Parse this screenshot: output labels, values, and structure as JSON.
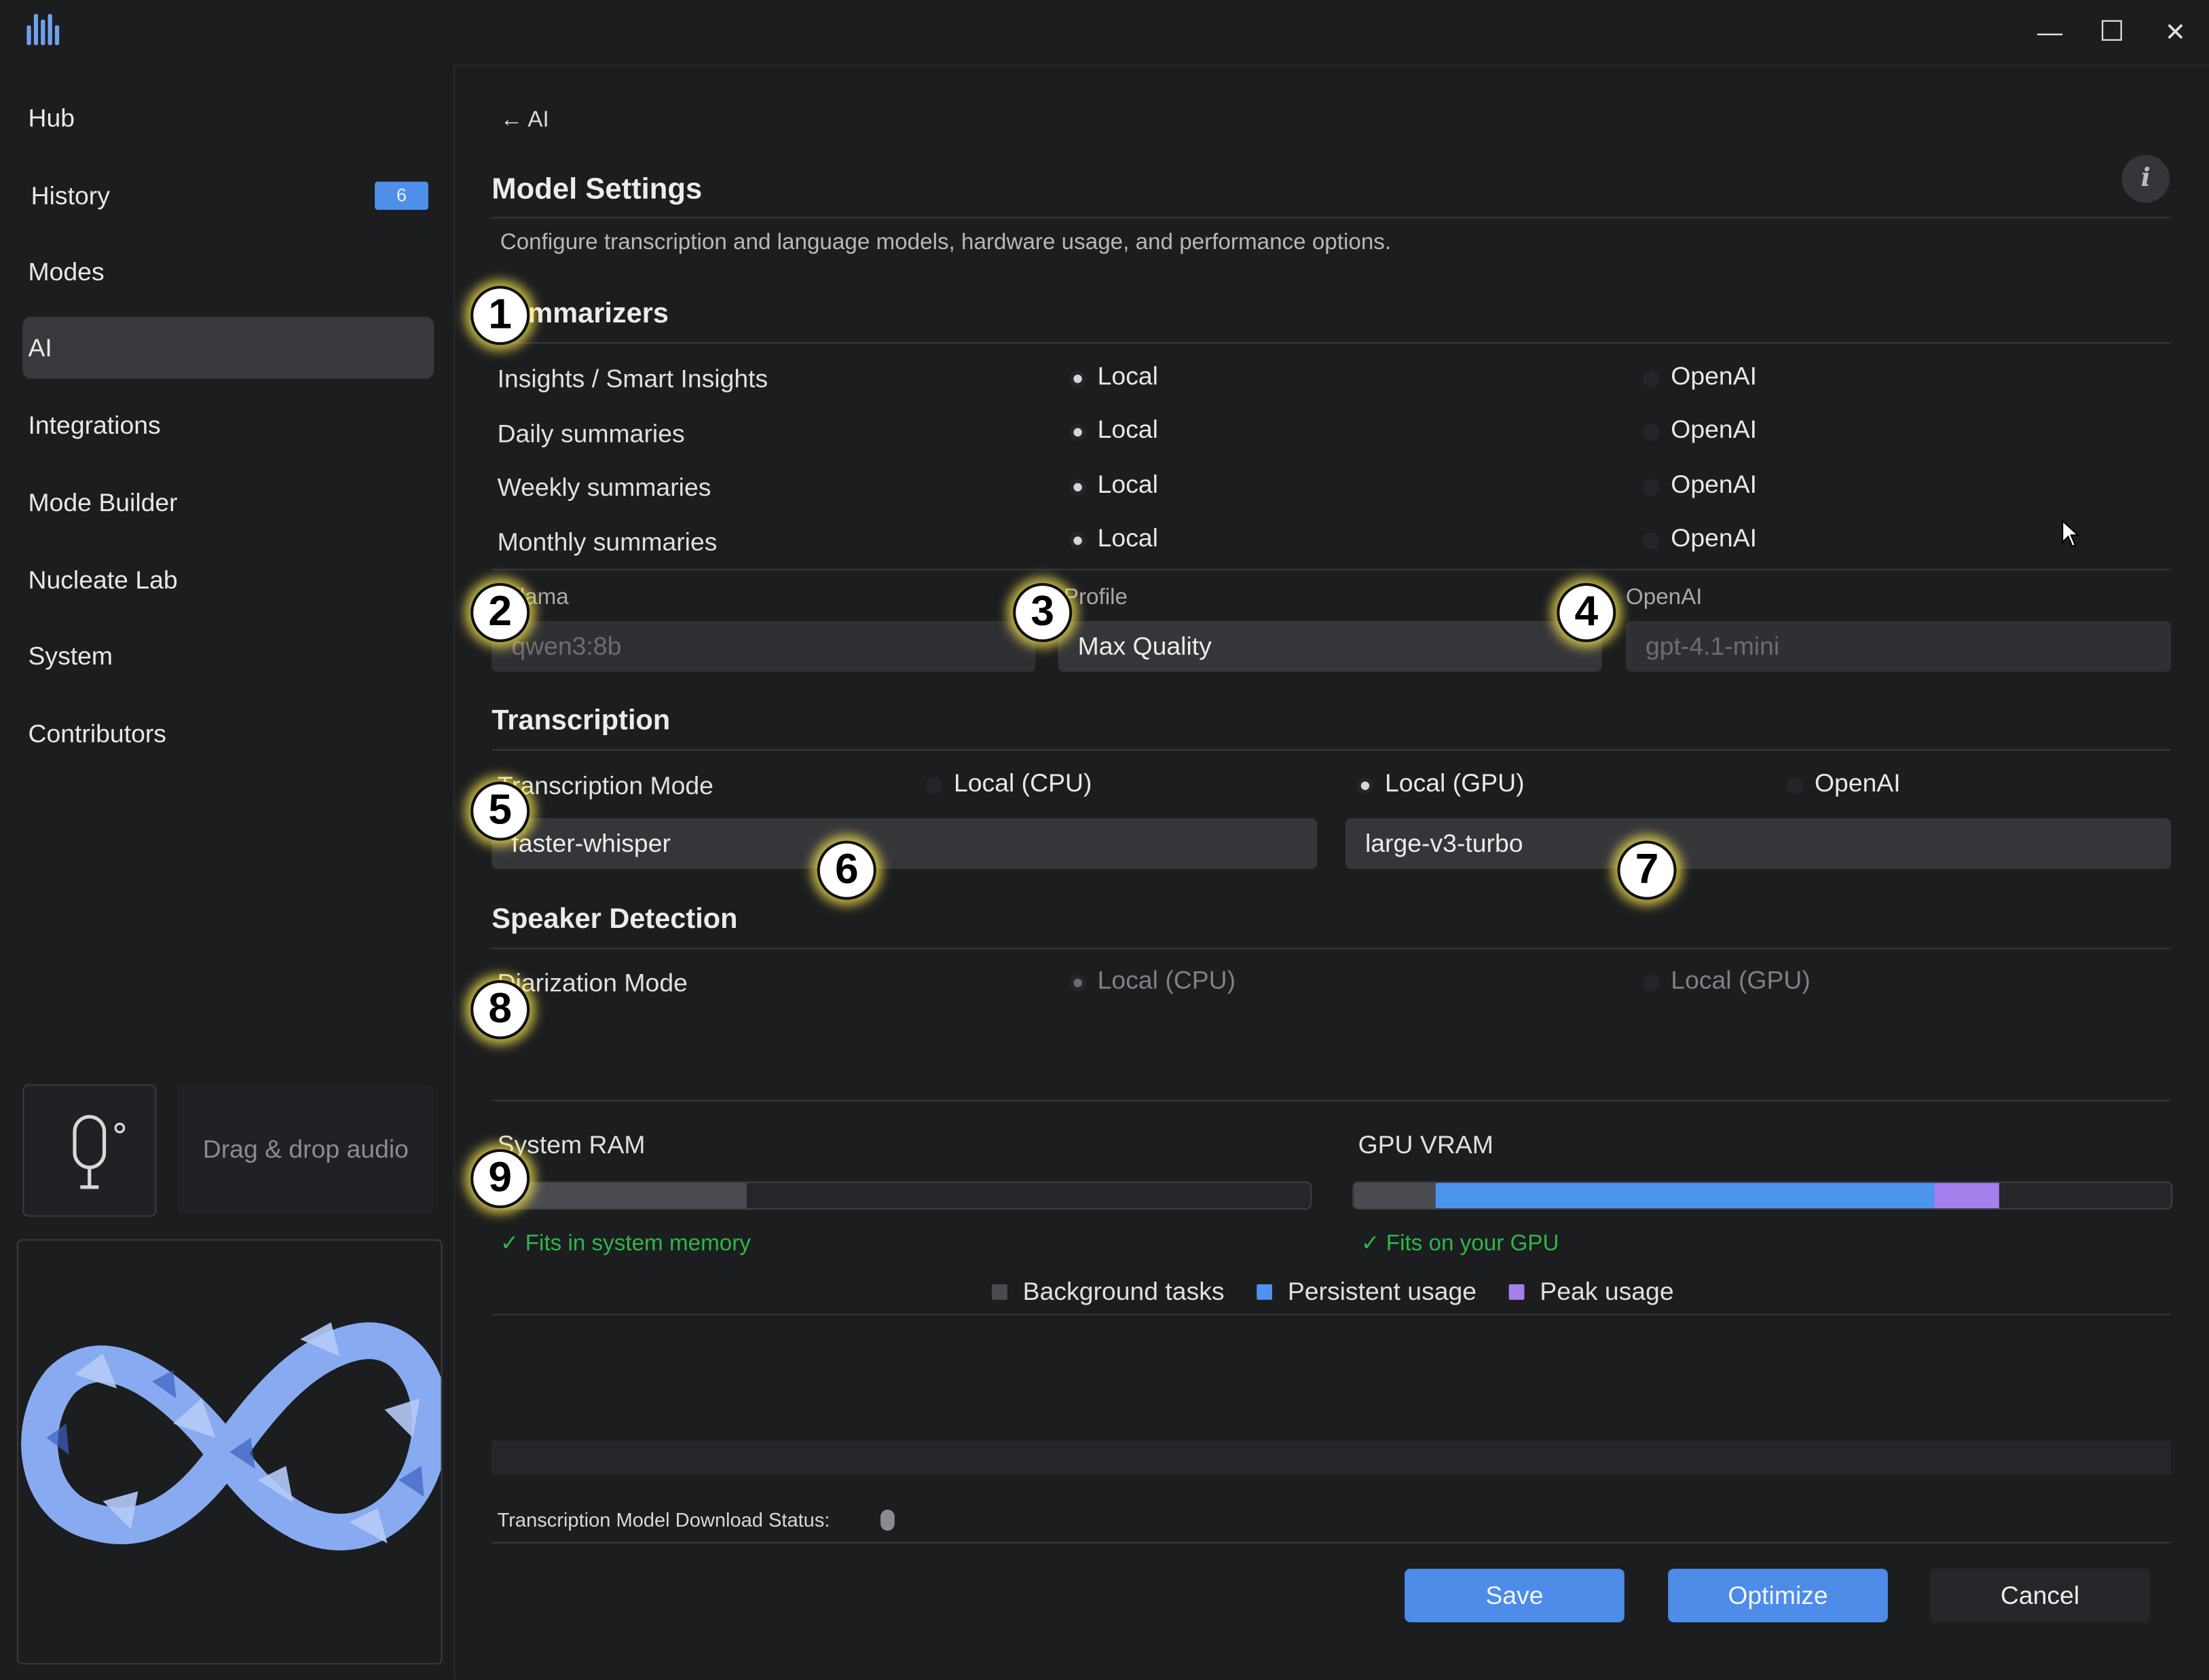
{
  "window": {
    "logo": "waveform-logo-icon",
    "controls": {
      "minimize": "—",
      "maximize": "☐",
      "close": "✕"
    }
  },
  "sidebar": {
    "items": [
      {
        "label": "Hub"
      },
      {
        "label": "History",
        "badge": "6"
      },
      {
        "label": "Modes"
      },
      {
        "label": "AI",
        "active": true
      },
      {
        "label": "Integrations"
      },
      {
        "label": "Mode Builder"
      },
      {
        "label": "Nucleate Lab"
      },
      {
        "label": "System"
      },
      {
        "label": "Contributors"
      }
    ],
    "drop_label": "Drag & drop audio"
  },
  "main": {
    "back_link": "← AI",
    "title": "Model Settings",
    "description": "Configure transcription and language models, hardware usage, and performance options.",
    "summarizers": {
      "heading": "Summarizers",
      "rows": [
        {
          "label": "Insights / Smart Insights",
          "local": "Local",
          "openai": "OpenAI",
          "selected": "local"
        },
        {
          "label": "Daily summaries",
          "local": "Local",
          "openai": "OpenAI",
          "selected": "local"
        },
        {
          "label": "Weekly summaries",
          "local": "Local",
          "openai": "OpenAI",
          "selected": "local"
        },
        {
          "label": "Monthly summaries",
          "local": "Local",
          "openai": "OpenAI",
          "selected": "local"
        }
      ],
      "ollama": {
        "label": "Ollama",
        "value": "qwen3:8b"
      },
      "profile": {
        "label": "Profile",
        "value": "Max Quality"
      },
      "openai": {
        "label": "OpenAI",
        "value": "gpt-4.1-mini"
      }
    },
    "transcription": {
      "heading": "Transcription",
      "mode_label": "Transcription Mode",
      "options": [
        "Local (CPU)",
        "Local (GPU)",
        "OpenAI"
      ],
      "selected": "Local (GPU)",
      "engine": "faster-whisper",
      "model": "large-v3-turbo"
    },
    "speaker": {
      "heading": "Speaker Detection",
      "mode_label": "Diarization Mode",
      "options": [
        "Local (CPU)",
        "Local (GPU)"
      ],
      "selected": "Local (CPU)"
    },
    "memory": {
      "ram": {
        "label": "System RAM",
        "fit": "✓ Fits in system memory",
        "background_fraction": 0.31
      },
      "vram": {
        "label": "GPU VRAM",
        "fit": "✓ Fits on your GPU",
        "background_fraction": 0.1,
        "persistent_fraction": 0.61,
        "peak_fraction": 0.08
      },
      "legend": [
        {
          "label": "Background tasks",
          "color": "#4a4b50"
        },
        {
          "label": "Persistent usage",
          "color": "#4d94ee"
        },
        {
          "label": "Peak usage",
          "color": "#a67fee"
        }
      ]
    },
    "download_status": "Transcription Model Download Status:",
    "buttons": {
      "save": "Save",
      "optimize": "Optimize",
      "cancel": "Cancel"
    }
  },
  "callouts": [
    "1",
    "2",
    "3",
    "4",
    "5",
    "6",
    "7",
    "8",
    "9"
  ],
  "colors": {
    "accent": "#4d8ce8",
    "success": "#2fb64a",
    "background": "#1c1d1f"
  }
}
